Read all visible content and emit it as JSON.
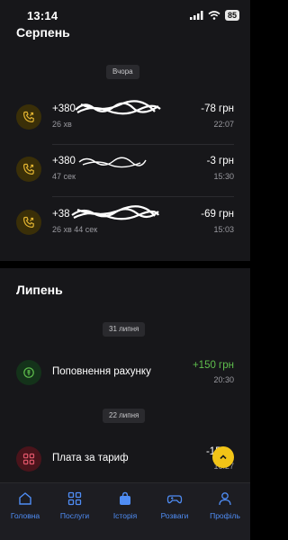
{
  "status_bar": {
    "time": "13:14",
    "battery": "85"
  },
  "sections": [
    {
      "month": "Серпень",
      "date_chip": "Вчора",
      "rows": [
        {
          "title": "+380",
          "subtitle": "26 хв",
          "amount": "-78 грн",
          "time": "22:07",
          "icon": "phone-call-icon"
        },
        {
          "title": "+380",
          "subtitle": "47 сек",
          "amount": "-3 грн",
          "time": "15:30",
          "icon": "phone-call-icon"
        },
        {
          "title": "+38",
          "subtitle": "26 хв 44 сек",
          "amount": "-69 грн",
          "time": "15:03",
          "icon": "phone-call-icon"
        }
      ]
    },
    {
      "month": "Липень",
      "groups": [
        {
          "date_chip": "31 липня",
          "rows": [
            {
              "title": "Поповнення рахунку",
              "amount": "+150 грн",
              "time": "20:30",
              "icon": "money-topup-icon"
            }
          ]
        },
        {
          "date_chip": "22 липня",
          "rows": [
            {
              "title": "Плата за тариф",
              "amount": "-150",
              "time": "16:27",
              "icon": "grid-tariff-icon"
            }
          ]
        }
      ]
    }
  ],
  "bottom_nav": [
    {
      "label": "Головна",
      "icon": "home-icon"
    },
    {
      "label": "Послуги",
      "icon": "services-grid-icon"
    },
    {
      "label": "Історія",
      "icon": "history-bag-icon"
    },
    {
      "label": "Розваги",
      "icon": "gamepad-icon"
    },
    {
      "label": "Профіль",
      "icon": "profile-icon"
    }
  ],
  "colors": {
    "accent": "#4f8df5",
    "positive": "#5fbf4d",
    "call_icon": "#e2b431",
    "scroll_button": "#f2c417"
  }
}
